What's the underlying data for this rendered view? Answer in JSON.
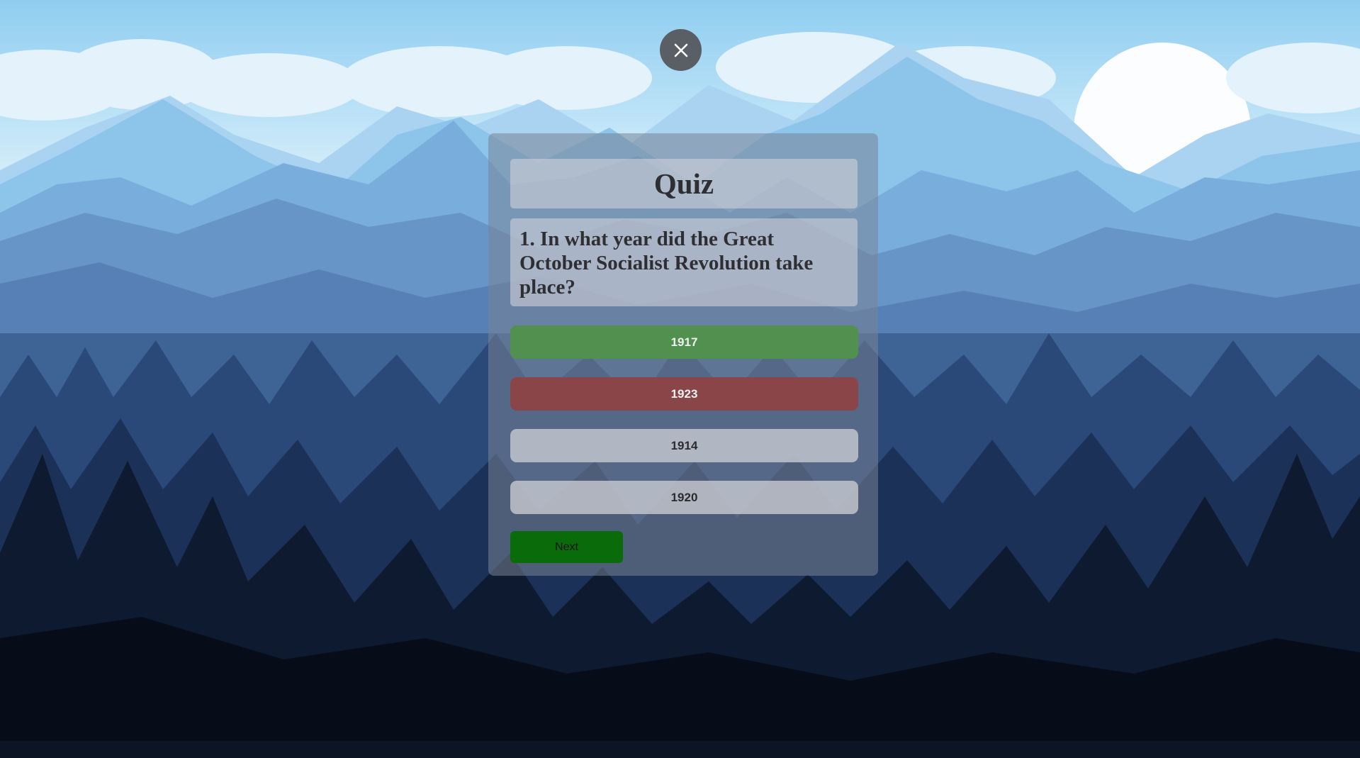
{
  "app": {
    "close_icon": "close-icon"
  },
  "quiz": {
    "title": "Quiz",
    "question": "1. In what year did the Great October Socialist Revolution take place?",
    "answers": [
      {
        "label": "1917",
        "state": "correct",
        "color": "#51904f"
      },
      {
        "label": "1923",
        "state": "wrong",
        "color": "#8a4549"
      },
      {
        "label": "1914",
        "state": "neutral"
      },
      {
        "label": "1920",
        "state": "neutral"
      }
    ],
    "next_label": "Next",
    "next_color": "#0a6b0a"
  }
}
